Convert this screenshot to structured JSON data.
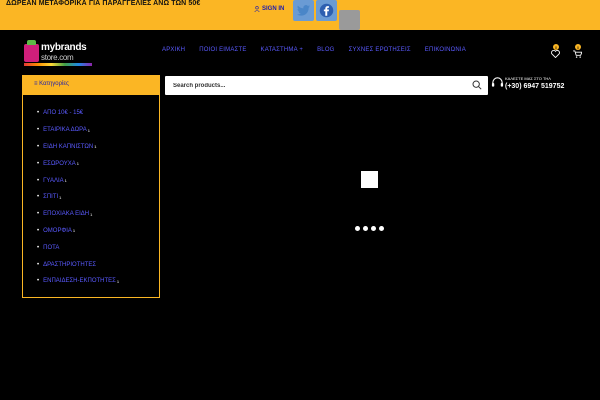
{
  "topbar": {
    "promo": "ΔΩΡΕΑΝ ΜΕΤΑΦΟΡΙΚΑ ΓΙΑ ΠΑΡΑΓΓΕΛΙΕΣ ΑΝΩ ΤΩΝ 50€",
    "signin": "SIGN IN"
  },
  "logo": {
    "line1": "mybrands",
    "line2": "store.com"
  },
  "nav": {
    "items": [
      "ΑΡΧΙΚΗ",
      "ΠΟΙΟΙ ΕΙΜΑΣΤΕ",
      "ΚΑΤΑΣΤΗΜΑ +",
      "BLOG",
      "ΣΥΧΝΕΣ ΕΡΩΤΗΣΕΙΣ",
      "ΕΠΙΚΟΙΝΩΝΙΑ"
    ]
  },
  "header": {
    "wishlist_count": "0",
    "cart_count": "0"
  },
  "categories": {
    "title": "Κατηγορίες",
    "items": [
      {
        "label": "ΑΠΟ 10€ - 15€",
        "sup": ""
      },
      {
        "label": "ΕΤΑΙΡΙΚΑ ΔΩΡΑ",
        "sup": "1"
      },
      {
        "label": "ΕΙΔΗ ΚΑΠΝΙΣΤΩΝ",
        "sup": "1"
      },
      {
        "label": "ΕΣΩΡΟΥΧΑ",
        "sup": "1"
      },
      {
        "label": "ΓΥΑΛΙΑ",
        "sup": "1"
      },
      {
        "label": "ΣΠΙΤΙ",
        "sup": "1"
      },
      {
        "label": "ΕΠΟΧΙΑΚΑ ΕΙΔΗ",
        "sup": "1"
      },
      {
        "label": "ΟΜΟΡΦΙΑ",
        "sup": "1"
      },
      {
        "label": "ΠΟΤΑ",
        "sup": ""
      },
      {
        "label": "ΔΡΑΣΤΗΡΙΟΤΗΤΕΣ",
        "sup": ""
      },
      {
        "label": "ΕΝΠΑΙΔΕΣΗ-ΕΚΠΟΤΗΤΕΣ",
        "sup": "1"
      }
    ]
  },
  "search": {
    "placeholder": "Search products..."
  },
  "contact": {
    "label": "ΚΑΛΕΣΤΕ ΜΑΣ ΣΤΟ ΤΗΛ",
    "phone": "(+30) 6947 519752"
  },
  "colors": {
    "accent": "#fbb624",
    "link": "#5a5aff",
    "background": "#000000"
  }
}
